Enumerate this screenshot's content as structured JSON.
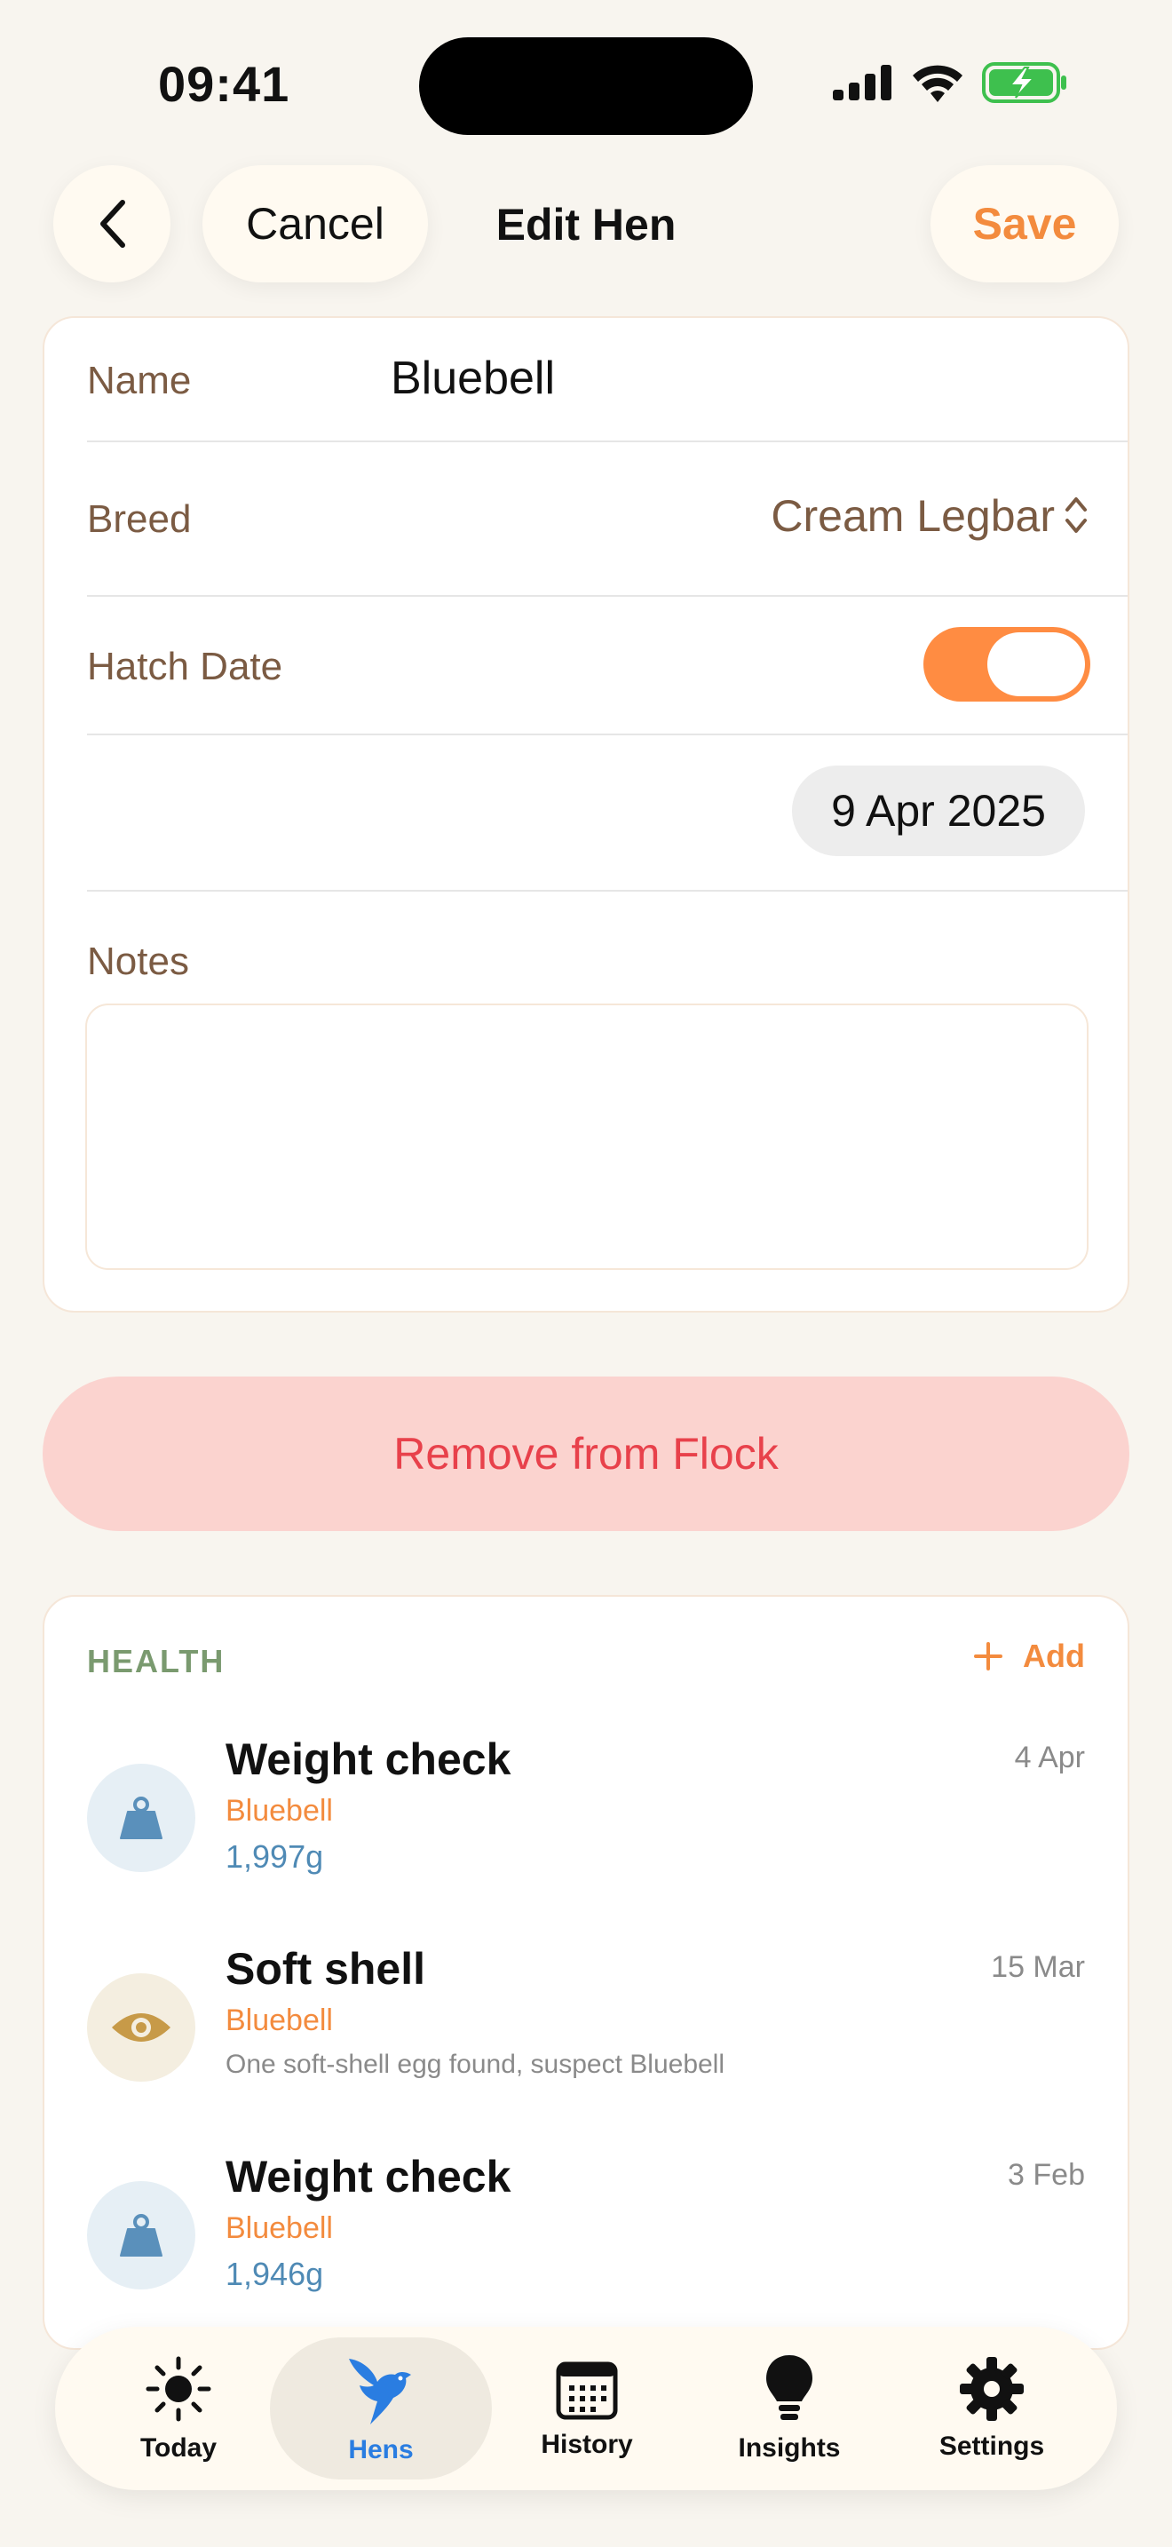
{
  "status_bar": {
    "time": "09:41"
  },
  "nav": {
    "cancel_label": "Cancel",
    "title": "Edit Hen",
    "save_label": "Save"
  },
  "form": {
    "name_label": "Name",
    "name_value": "Bluebell",
    "breed_label": "Breed",
    "breed_value": "Cream Legbar",
    "hatch_label": "Hatch Date",
    "hatch_enabled": true,
    "hatch_date": "9 Apr 2025",
    "notes_label": "Notes",
    "notes_value": ""
  },
  "remove_label": "Remove from Flock",
  "health": {
    "section_title": "HEALTH",
    "add_label": "Add",
    "items": [
      {
        "title": "Weight check",
        "date": "4 Apr",
        "hen": "Bluebell",
        "value": "1,997g",
        "icon": "weight-icon"
      },
      {
        "title": "Soft shell",
        "date": "15 Mar",
        "hen": "Bluebell",
        "note": "One soft-shell egg found, suspect Bluebell",
        "icon": "eye-icon"
      },
      {
        "title": "Weight check",
        "date": "3 Feb",
        "hen": "Bluebell",
        "value": "1,946g",
        "icon": "weight-icon"
      }
    ]
  },
  "tabs": [
    {
      "label": "Today",
      "icon": "sun-icon"
    },
    {
      "label": "Hens",
      "icon": "bird-icon",
      "active": true
    },
    {
      "label": "History",
      "icon": "calendar-icon"
    },
    {
      "label": "Insights",
      "icon": "lightbulb-icon"
    },
    {
      "label": "Settings",
      "icon": "gear-icon"
    }
  ],
  "colors": {
    "accent": "#f38b3e",
    "toggle": "#ff8c42",
    "destructive": "#e8414b",
    "tab_active": "#2a7de1"
  }
}
